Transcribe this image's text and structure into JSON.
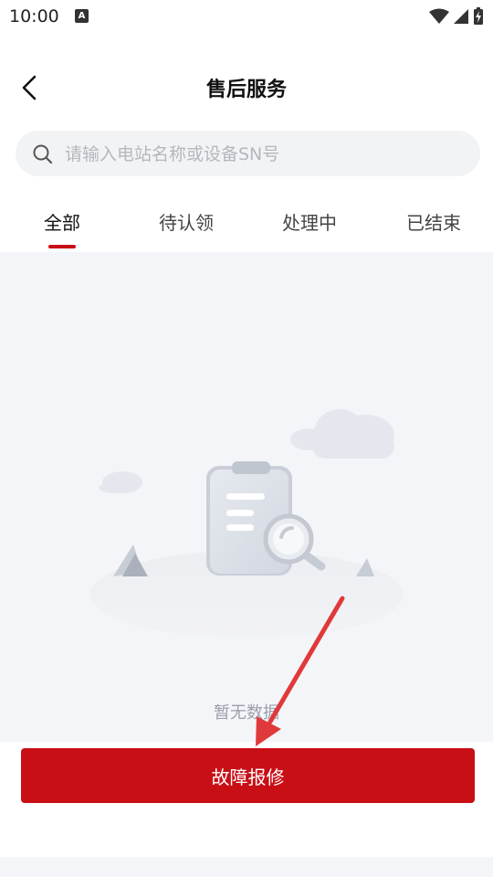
{
  "status_bar": {
    "time": "10:00",
    "notification_letter": "A"
  },
  "header": {
    "title": "售后服务"
  },
  "search": {
    "placeholder": "请输入电站名称或设备SN号",
    "value": ""
  },
  "tabs": [
    {
      "label": "全部",
      "active": true
    },
    {
      "label": "待认领",
      "active": false
    },
    {
      "label": "处理中",
      "active": false
    },
    {
      "label": "已结束",
      "active": false
    }
  ],
  "empty_state": {
    "text": "暂无数据"
  },
  "action": {
    "report_label": "故障报修"
  },
  "colors": {
    "accent": "#c90f16",
    "arrow": "#e0393b",
    "background": "#f4f5f8"
  }
}
